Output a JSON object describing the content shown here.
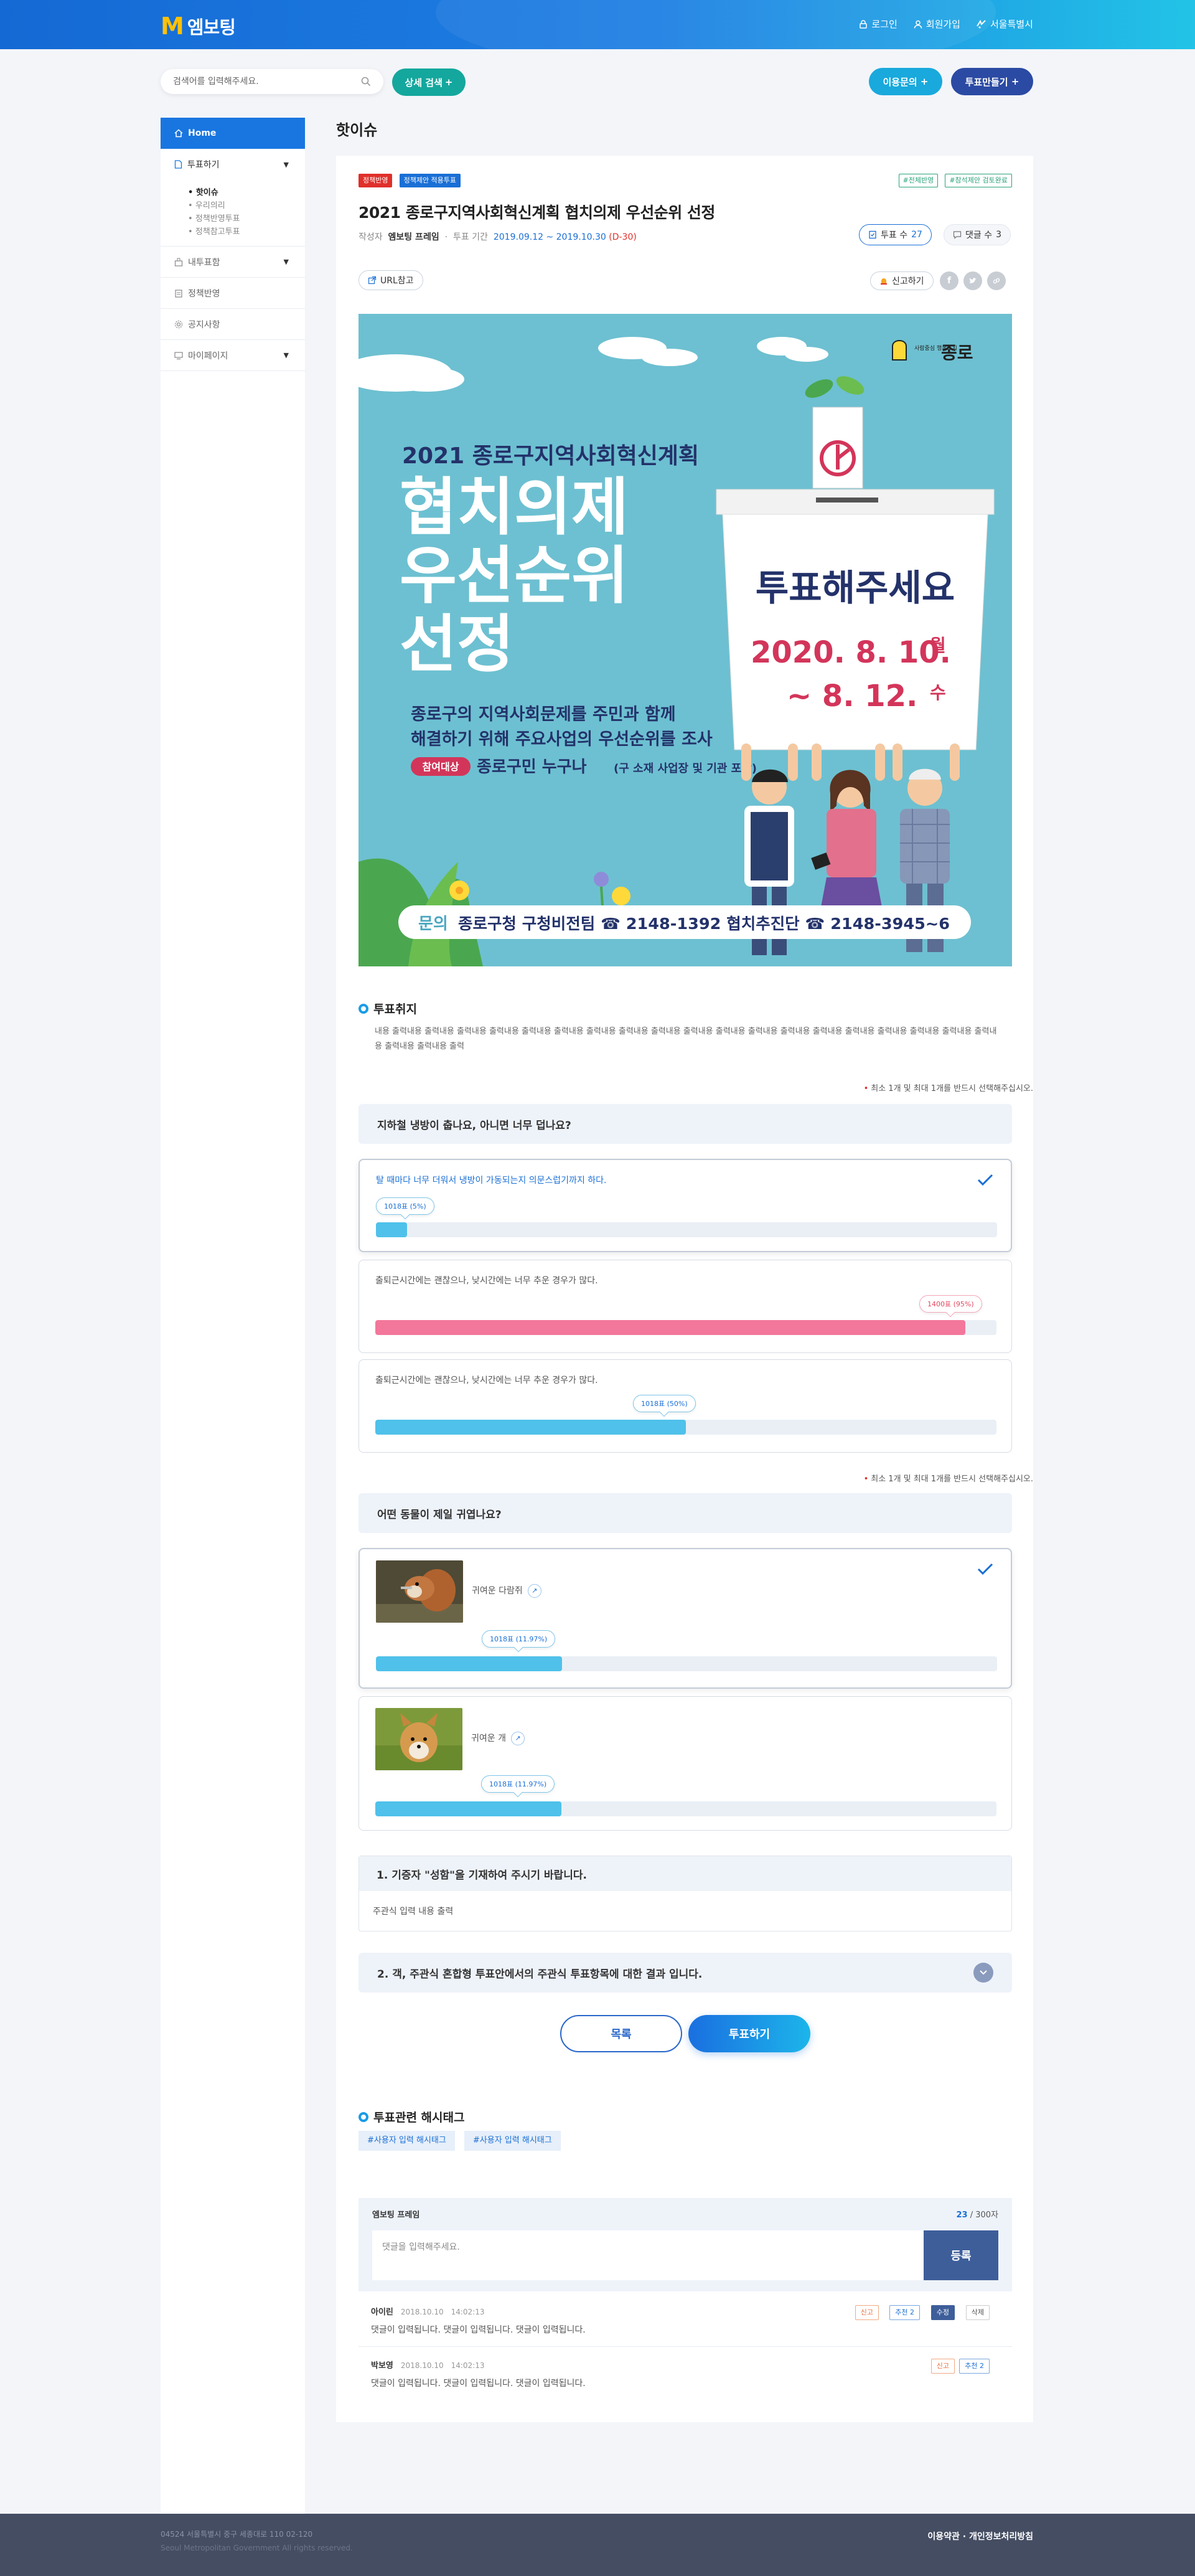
{
  "header": {
    "logo_mark": "M",
    "logo_text": "엠보팅",
    "nav": [
      "로그인",
      "회원가입",
      "서울특별시"
    ]
  },
  "search": {
    "placeholder": "검색어를 입력해주세요.",
    "detail_btn": "상세 검색",
    "vote_log_btn": "이용문의",
    "make_vote_btn": "투표만들기"
  },
  "sidebar": {
    "home": "Home",
    "vote": "투표하기",
    "sub": [
      "핫이슈",
      "우리의리",
      "정책반영투표",
      "정책참고투표"
    ],
    "my_vote": "내투표함",
    "policy": "정책반영",
    "notice": "공지사항",
    "mypage": "마이페이지"
  },
  "page_title": "핫이슈",
  "post": {
    "tags": [
      "정책반영",
      "정책제안 적용투표"
    ],
    "right_tags": [
      "#전체반영",
      "#참석제안 검토완료"
    ],
    "title": "2021 종로구지역사회혁신계획 협치의제 우선순위 선정",
    "author_label": "작성자",
    "author": "엠보팅 프레임",
    "period_label": "투표 기간",
    "period": "2019.09.12 ~ 2019.10.30",
    "dday": "(D-30)",
    "vote_count": "투표 수",
    "vote_num": "27",
    "comment_count": "댓글 수",
    "comment_num": "3",
    "url_btn": "URL참고",
    "report_btn": "신고하기"
  },
  "banner": {
    "logo": "종로",
    "logo_sub": "사람중심 행복도시",
    "line1": "2021 종로구지역사회혁신계획",
    "big1": "협치의제",
    "big2": "우선순위",
    "big3": "선정",
    "desc1": "종로구의 지역사회문제를 주민과 함께",
    "desc2": "해결하기 위해 주요사업의 우선순위를 조사",
    "target_label": "참여대상",
    "target": "종로구민 누구나",
    "target_sub": "(구 소재 사업장 및 기관 포함)",
    "vote_text": "투표해주세요",
    "date1": "2020. 8. 10.",
    "day1": "월",
    "date2": "~ 8. 12.",
    "day2": "수",
    "contact_label": "문의",
    "contact": "종로구청 구청비전팀 ☎ 2148-1392 협치추진단 ☎ 2148-3945~6"
  },
  "purpose": {
    "heading": "투표취지",
    "text": "내용 출력내용 출력내용 출력내용 출력내용 출력내용 출력내용 출력내용 출력내용 출력내용 출력내용 출력내용 출력내용 출력내용 출력내용 출력내용 출력내용 출력내용 출력내용 출력내용 출력내용 출력내용 출력"
  },
  "note": "최소 1개 및 최대 1개를 반드시 선택해주십시오.",
  "q1": {
    "question": "지하철 냉방이 춥나요, 아니면 너무 덥나요?",
    "options": [
      {
        "text": "탈 때마다 너무 더워서 냉방이 가동되는지 의문스럽기까지 하다.",
        "votes": "1018표 (5%)",
        "pct": 5
      },
      {
        "text": "출퇴근시간에는 괜찮으나, 낮시간에는 너무 추운 경우가 많다.",
        "votes": "1400표 (95%)",
        "pct": 95
      },
      {
        "text": "출퇴근시간에는 괜찮으나, 낮시간에는 너무 추운 경우가 많다.",
        "votes": "1018표 (50%)",
        "pct": 50
      }
    ]
  },
  "q2": {
    "question": "어떤 동물이 제일 귀엽나요?",
    "options": [
      {
        "text": "귀여운 다람쥐",
        "votes": "1018표 (11.97%)",
        "pct": 30
      },
      {
        "text": "귀여운 개",
        "votes": "1018표 (11.97%)",
        "pct": 30
      }
    ]
  },
  "q3": {
    "question": "1. 기증자 \"성함\"을 기재하여 주시기 바랍니다.",
    "answer": "주관식 입력 내용 출력"
  },
  "q4": {
    "question": "2. 객, 주관식 혼합형 투표안에서의 주관식 투표항목에 대한 결과 입니다."
  },
  "buttons": {
    "list": "목록",
    "vote": "투표하기"
  },
  "hashtags": {
    "heading": "투표관련 해시태그",
    "items": [
      "#사용자 입력 해시태그",
      "#사용자 입력 해시태그"
    ]
  },
  "comment_form": {
    "name": "엠보팅 프레임",
    "count": "23",
    "max": " / 300자",
    "placeholder": "댓글을 입력해주세요.",
    "submit": "등록"
  },
  "comments": [
    {
      "name": "아이린",
      "date": "2018.10.10",
      "time": "14:02:13",
      "text": "댓글이 입력됩니다. 댓글이 입력됩니다. 댓글이 입력됩니다.",
      "actions": [
        "신고",
        "추천 2",
        "수정",
        "삭제"
      ]
    },
    {
      "name": "박보영",
      "date": "2018.10.10",
      "time": "14:02:13",
      "text": "댓글이 입력됩니다. 댓글이 입력됩니다. 댓글이 입력됩니다.",
      "actions": [
        "신고",
        "추천 2"
      ]
    }
  ],
  "footer": {
    "addr": "04524 서울특별시 중구 세종대로 110   02-120",
    "copy": "Seoul Metropolitan Government All rights reserved.",
    "links": "이용약관 · 개인정보처리방침"
  }
}
